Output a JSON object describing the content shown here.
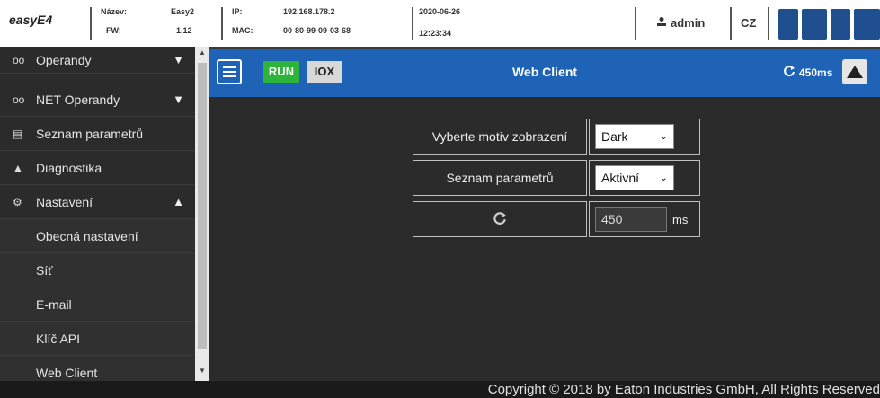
{
  "header": {
    "app_name": "easyE4",
    "name_label": "Název:",
    "name_value": "Easy2",
    "fw_label": "FW:",
    "fw_value": "1.12",
    "ip_label": "IP:",
    "ip_value": "192.168.178.2",
    "mac_label": "MAC:",
    "mac_value": "00-80-99-09-03-68",
    "date": "2020-06-26",
    "time": "12:23:34",
    "user": "admin",
    "language": "CZ",
    "brand": "EATON"
  },
  "sidebar": {
    "items": [
      {
        "label": "Operandy",
        "icon": "glasses-icon"
      },
      {
        "label": "NET Operandy",
        "icon": "glasses-icon"
      },
      {
        "label": "Seznam parametrů",
        "icon": "list-icon"
      },
      {
        "label": "Diagnostika",
        "icon": "warning-icon"
      },
      {
        "label": "Nastavení",
        "icon": "gear-icon"
      }
    ],
    "subitems": [
      "Obecná nastavení",
      "Síť",
      "E-mail",
      "Klíč API",
      "Web Client"
    ]
  },
  "toolbar": {
    "run_label": "RUN",
    "iox_label": "IOX",
    "title": "Web Client",
    "refresh_label": "450ms"
  },
  "form": {
    "theme_label": "Vyberte motiv zobrazení",
    "theme_value": "Dark",
    "params_label": "Seznam parametrů",
    "params_value": "Aktivní",
    "interval_value": "450",
    "interval_unit": "ms"
  },
  "footer": {
    "copyright": "Copyright © 2018 by Eaton Industries GmbH, All Rights Reserved"
  },
  "colors": {
    "accent": "#1e63b6",
    "run": "#2cb53a",
    "background": "#2b2b2b",
    "brand": "#1f4f8f"
  }
}
